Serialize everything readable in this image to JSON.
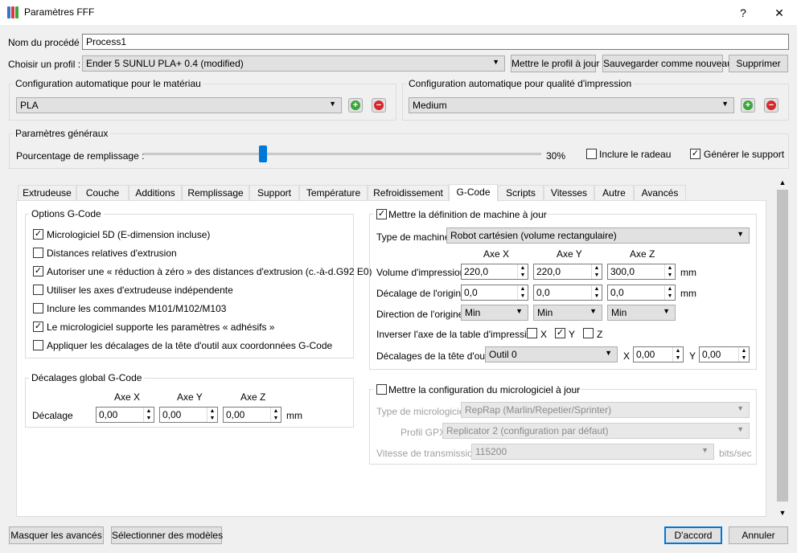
{
  "window": {
    "title": "Paramètres FFF",
    "help_glyph": "?",
    "close_glyph": "✕"
  },
  "process": {
    "label": "Nom du procédé :",
    "value": "Process1"
  },
  "profile": {
    "label": "Choisir un profil :",
    "value": "Ender 5 SUNLU PLA+ 0.4 (modified)",
    "update_btn": "Mettre le profil à jour",
    "save_btn": "Sauvegarder comme nouveau",
    "delete_btn": "Supprimer"
  },
  "material": {
    "legend": "Configuration automatique pour le matériau",
    "value": "PLA"
  },
  "quality": {
    "legend": "Configuration automatique pour qualité d'impression",
    "value": "Medium"
  },
  "general": {
    "legend": "Paramètres généraux",
    "infill_label": "Pourcentage de remplissage :",
    "infill_value": "30%",
    "infill_fraction": 0.3,
    "raft_label": "Inclure le radeau",
    "raft_checked": false,
    "support_label": "Générer le support",
    "support_checked": true
  },
  "tabs": [
    "Extrudeuse",
    "Couche",
    "Additions",
    "Remplissage",
    "Support",
    "Température",
    "Refroidissement",
    "G-Code",
    "Scripts",
    "Vitesses",
    "Autre",
    "Avancés"
  ],
  "active_tab": "G-Code",
  "gcode_options": {
    "legend": "Options G-Code",
    "items": [
      {
        "label": "Micrologiciel 5D (E-dimension incluse)",
        "checked": true
      },
      {
        "label": "Distances relatives d'extrusion",
        "checked": false
      },
      {
        "label": "Autoriser une « réduction à zéro » des distances d'extrusion (c.-à-d.G92 E0)",
        "checked": true
      },
      {
        "label": "Utiliser les axes d'extrudeuse indépendente",
        "checked": false
      },
      {
        "label": "Inclure les commandes M101/M102/M103",
        "checked": false
      },
      {
        "label": "Le micrologiciel supporte les paramètres « adhésifs »",
        "checked": true
      },
      {
        "label": "Appliquer les décalages de la tête d'outil aux coordonnées G-Code",
        "checked": false
      }
    ]
  },
  "global_offsets": {
    "legend": "Décalages global G-Code",
    "axis_x": "Axe X",
    "axis_y": "Axe Y",
    "axis_z": "Axe Z",
    "row_label": "Décalage",
    "x": "0,00",
    "y": "0,00",
    "z": "0,00",
    "unit": "mm"
  },
  "machine": {
    "header": "Mettre la définition de machine à jour",
    "header_checked": true,
    "type_label": "Type de machine",
    "type_value": "Robot cartésien (volume rectangulaire)",
    "axis_x": "Axe X",
    "axis_y": "Axe Y",
    "axis_z": "Axe Z",
    "volume_label": "Volume d'impression",
    "volume": [
      "220,0",
      "220,0",
      "300,0"
    ],
    "origin_label": "Décalage de l'origine",
    "origin": [
      "0,0",
      "0,0",
      "0,0"
    ],
    "direction_label": "Direction de l'origine",
    "direction": [
      "Min",
      "Min",
      "Min"
    ],
    "unit": "mm",
    "invert_label": "Inverser l'axe de la table d'impression",
    "invert": [
      {
        "label": "X",
        "checked": false
      },
      {
        "label": "Y",
        "checked": true
      },
      {
        "label": "Z",
        "checked": false
      }
    ],
    "toolhead_label": "Décalages de la tête d'outil",
    "toolhead_value": "Outil 0",
    "toolhead_x_label": "X",
    "toolhead_x": "0,00",
    "toolhead_y_label": "Y",
    "toolhead_y": "0,00"
  },
  "firmware": {
    "header": "Mettre la configuration du micrologiciel à jour",
    "header_checked": false,
    "type_label": "Type de micrologiciel",
    "type_value": "RepRap (Marlin/Repetier/Sprinter)",
    "gpx_label": "Profil GPX",
    "gpx_value": "Replicator 2 (configuration par défaut)",
    "baud_label": "Vitesse de transmission",
    "baud_value": "115200",
    "baud_unit": "bits/sec"
  },
  "footer": {
    "hide_advanced": "Masquer les avancés",
    "select_models": "Sélectionner des modèles",
    "ok": "D'accord",
    "cancel": "Annuler"
  },
  "colors": {
    "accent": "#0078d7",
    "add": "#3aa63a",
    "remove": "#d9262c"
  }
}
